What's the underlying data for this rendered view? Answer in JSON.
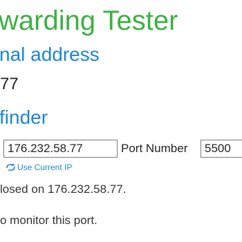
{
  "site": {
    "title": "warding Tester"
  },
  "external_address": {
    "heading": "nal address",
    "ip": "77"
  },
  "port_finder": {
    "heading": "finder",
    "ip_value": "176.232.58.77",
    "port_label": "Port Number",
    "port_value": "5500",
    "use_current_ip_label": "Use Current IP"
  },
  "result": {
    "status_text": "losed on 176.232.58.77.",
    "monitor_text": "o monitor this port."
  },
  "colors": {
    "title_green": "#3cb043",
    "heading_blue": "#1c86d6",
    "link_blue": "#1c86d6"
  },
  "icons": {
    "use_current_ip": "refresh-arrow-icon"
  }
}
